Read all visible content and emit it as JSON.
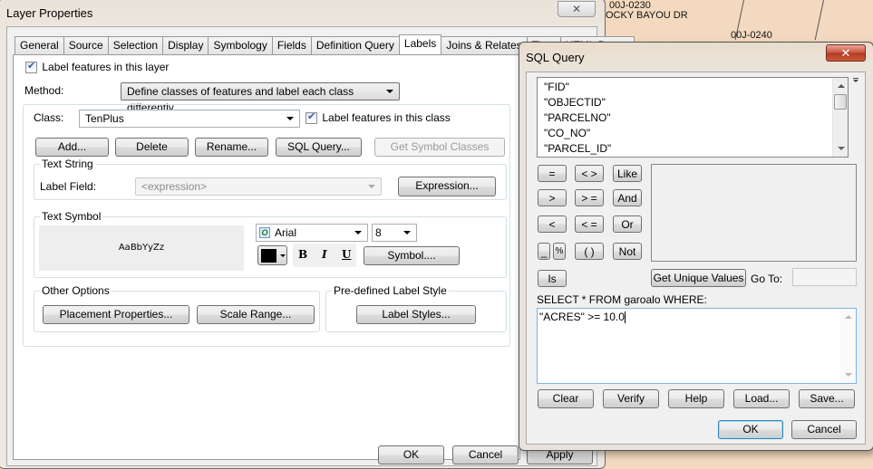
{
  "map": {
    "labels": [
      "00J-0230",
      "OCKY BAYOU DR",
      "00J-0240"
    ]
  },
  "layer_properties": {
    "title": "Layer Properties",
    "close_glyph": "✕",
    "tabs": [
      {
        "label": "General",
        "active": false
      },
      {
        "label": "Source",
        "active": false
      },
      {
        "label": "Selection",
        "active": false
      },
      {
        "label": "Display",
        "active": false
      },
      {
        "label": "Symbology",
        "active": false
      },
      {
        "label": "Fields",
        "active": false
      },
      {
        "label": "Definition Query",
        "active": false
      },
      {
        "label": "Labels",
        "active": true
      },
      {
        "label": "Joins & Relates",
        "active": false
      },
      {
        "label": "Time",
        "active": false
      },
      {
        "label": "HTML Popup",
        "active": false
      }
    ],
    "label_features_layer": {
      "label": "Label features in this layer",
      "checked": true
    },
    "method": {
      "label": "Method:",
      "value": "Define classes of features and label each class differently."
    },
    "class": {
      "label": "Class:",
      "value": "TenPlus"
    },
    "label_features_class": {
      "label": "Label features in this class",
      "checked": true
    },
    "class_buttons": {
      "add": "Add...",
      "delete": "Delete",
      "rename": "Rename...",
      "sql_query": "SQL Query...",
      "get_symbol_classes": "Get Symbol Classes"
    },
    "text_string": {
      "title": "Text String",
      "label_field_label": "Label Field:",
      "label_field_value": "<expression>",
      "expression_button": "Expression..."
    },
    "text_symbol": {
      "title": "Text Symbol",
      "preview": "AaBbYyZz",
      "font": "Arial",
      "size": "8",
      "color": "#000000",
      "bold": "B",
      "italic": "I",
      "underline": "U",
      "symbol_button": "Symbol...."
    },
    "other_options": {
      "title": "Other Options",
      "placement": "Placement Properties...",
      "scale_range": "Scale Range..."
    },
    "predefined": {
      "title": "Pre-defined Label Style",
      "label_styles": "Label Styles..."
    },
    "footer": {
      "ok": "OK",
      "cancel": "Cancel",
      "apply": "Apply"
    }
  },
  "sql_query": {
    "title": "SQL Query",
    "close_glyph": "✕",
    "fields": [
      "\"FID\"",
      "\"OBJECTID\"",
      "\"PARCELNO\"",
      "\"CO_NO\"",
      "\"PARCEL_ID\""
    ],
    "operators": [
      [
        "=",
        "< >",
        "Like"
      ],
      [
        ">",
        "> =",
        "And"
      ],
      [
        "<",
        "< =",
        "Or"
      ],
      [
        "_",
        "%",
        "( )",
        "Not"
      ],
      [
        "Is"
      ]
    ],
    "get_unique_values": "Get Unique Values",
    "goto_label": "Go To:",
    "goto_value": "",
    "select_prefix": "SELECT * FROM garoalo WHERE:",
    "expression": "\"ACRES\" >= 10.0",
    "buttons": {
      "clear": "Clear",
      "verify": "Verify",
      "help": "Help",
      "load": "Load...",
      "save": "Save..."
    },
    "ok": "OK",
    "cancel": "Cancel"
  }
}
